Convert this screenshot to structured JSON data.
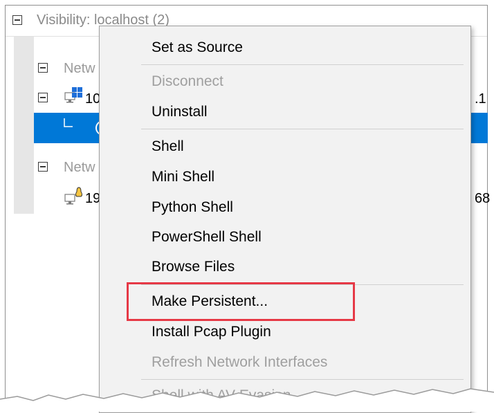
{
  "window": {
    "title": "Visibility: localhost (2)"
  },
  "tree": {
    "group1_label": "Netw",
    "host1_label": "10",
    "host1_right_label": ".1",
    "group2_label": "Netw",
    "host2_label": "19",
    "host2_right_label": "68"
  },
  "context_menu": {
    "items": [
      {
        "label": "Set as Source",
        "enabled": true
      },
      {
        "label": "Disconnect",
        "enabled": false
      },
      {
        "label": "Uninstall",
        "enabled": true
      },
      {
        "label": "Shell",
        "enabled": true
      },
      {
        "label": "Mini Shell",
        "enabled": true
      },
      {
        "label": "Python Shell",
        "enabled": true
      },
      {
        "label": "PowerShell Shell",
        "enabled": true
      },
      {
        "label": "Browse Files",
        "enabled": true
      },
      {
        "label": "Make Persistent...",
        "enabled": true,
        "highlighted": true
      },
      {
        "label": "Install Pcap Plugin",
        "enabled": true
      },
      {
        "label": "Refresh Network Interfaces",
        "enabled": false
      },
      {
        "label": "Shell with AV Evasion",
        "enabled": false
      }
    ]
  },
  "colors": {
    "selection": "#0078d7",
    "highlight_box": "#e63946"
  }
}
